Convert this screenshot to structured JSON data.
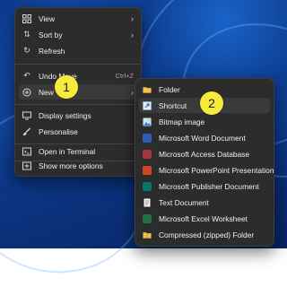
{
  "context_menu": {
    "items": [
      {
        "label": "View",
        "icon": "grid-icon",
        "has_submenu": true
      },
      {
        "label": "Sort by",
        "icon": "sort-icon",
        "has_submenu": true
      },
      {
        "label": "Refresh",
        "icon": "refresh-icon"
      },
      {
        "label": "Undo Move",
        "icon": "undo-icon",
        "shortcut": "Ctrl+Z"
      },
      {
        "label": "New",
        "icon": "new-icon",
        "has_submenu": true
      },
      {
        "label": "Display settings",
        "icon": "display-icon"
      },
      {
        "label": "Personalise",
        "icon": "brush-icon"
      },
      {
        "label": "Open in Terminal",
        "icon": "terminal-icon"
      },
      {
        "label": "Show more options",
        "icon": "more-options-icon"
      }
    ]
  },
  "new_submenu": {
    "items": [
      {
        "label": "Folder",
        "icon": "folder-icon",
        "color": "#f2c14e"
      },
      {
        "label": "Shortcut",
        "icon": "shortcut-icon",
        "color": "#5aa0e6"
      },
      {
        "label": "Bitmap image",
        "icon": "bitmap-icon",
        "color": "#5aa0e6"
      },
      {
        "label": "Microsoft Word Document",
        "icon": "word-icon",
        "color": "#2b5fb4"
      },
      {
        "label": "Microsoft Access Database",
        "icon": "access-icon",
        "color": "#a4373a"
      },
      {
        "label": "Microsoft PowerPoint Presentation",
        "icon": "powerpoint-icon",
        "color": "#d04423"
      },
      {
        "label": "Microsoft Publisher Document",
        "icon": "publisher-icon",
        "color": "#077568"
      },
      {
        "label": "Text Document",
        "icon": "text-doc-icon",
        "color": "#dddddd"
      },
      {
        "label": "Microsoft Excel Worksheet",
        "icon": "excel-icon",
        "color": "#1e7145"
      },
      {
        "label": "Compressed (zipped) Folder",
        "icon": "zip-folder-icon",
        "color": "#f2c14e"
      }
    ]
  },
  "callouts": [
    "1",
    "2"
  ]
}
